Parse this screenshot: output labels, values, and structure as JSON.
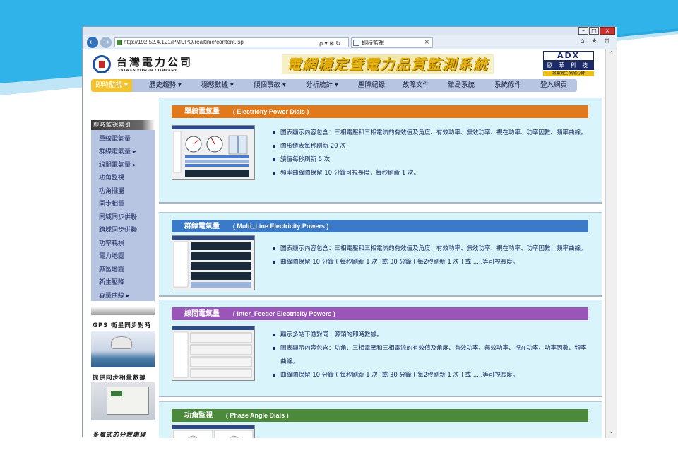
{
  "browser": {
    "url": "http://192.52.4.121/PMUPQ/realtime/content.jsp",
    "address_icons": "ρ ▾ ⊠ ↻",
    "tab_title": "即時監視",
    "tab_close": "×",
    "toolbar_icons": "⌂ ★ ⚙",
    "window_buttons": [
      "–",
      "□",
      "×"
    ],
    "back_glyph": "←",
    "forward_glyph": "→",
    "scroll_up": "⌃",
    "scroll_down": "⌄"
  },
  "header": {
    "company_name": "台灣電力公司",
    "company_name_en": "TAIWAN POWER COMPANY",
    "system_title": "電網穩定暨電力品質監測系統",
    "brand_mark": "ADX",
    "brand_name": "歐 華 科 技",
    "brand_slogan": "念動氣生‧氣隨心轉"
  },
  "menu": [
    {
      "label": "即時監視 ▾",
      "active": true
    },
    {
      "label": "歷史趨勢 ▾",
      "active": false
    },
    {
      "label": "穩態數據 ▾",
      "active": false
    },
    {
      "label": "傾個事故 ▾",
      "active": false
    },
    {
      "label": "分析統計 ▾",
      "active": false
    },
    {
      "label": "壓降紀錄",
      "active": false
    },
    {
      "label": "故障文件",
      "active": false
    },
    {
      "label": "離島系統",
      "active": false
    },
    {
      "label": "系統條件",
      "active": false
    },
    {
      "label": "登入網頁",
      "active": false
    }
  ],
  "sidebar": {
    "heading": "即時監視索引",
    "items": [
      "單線電氣量",
      "群線電氣量 ▸",
      "線間電氣量 ▸",
      "功角監視",
      "功角擺盪",
      "同步相量",
      "同域同步併聯",
      "跨域同步併聯",
      "功率耗損",
      "電力地圖",
      "廠區地圖",
      "新生壓降",
      "容量曲線 ▸"
    ],
    "gps_label": "GPS 衛星同步對時",
    "sync_label": "提供同步相量數據",
    "dist_label": "多層式的分散處理"
  },
  "sections": [
    {
      "title_cn": "單線電氣量",
      "title_en": "( Electricity Power Dials )",
      "color": "#e07a1c",
      "bullets": [
        "圖表顯示內容包含：三相電壓和三相電流的有效值及角度、有效功率、無效功率、視在功率、功率因數、頻率曲線。",
        "圖形儀表每秒刷新 20 次",
        "讀值每秒刷新 5 次",
        "頻率曲線圖保留 10 分鐘可視長度，每秒刷新 1 次。"
      ]
    },
    {
      "title_cn": "群線電氣量",
      "title_en": "( Multi_Line Electricity Powers )",
      "color": "#3a7ac8",
      "bullets": [
        "圖表顯示內容包含：三相電壓和三相電流的有效值及角度、有效功率、無效功率、視在功率、功率因數、頻率曲線。",
        "曲線圖保留 10 分鐘 ( 每秒刷新 1 次 )或 30 分鐘 ( 每2秒刷新 1 次 ) 或 .....等可視長度。"
      ]
    },
    {
      "title_cn": "線間電氣量",
      "title_en": "( Inter_Feeder Electricity Powers )",
      "color": "#9a55b8",
      "bullets": [
        "顯示多站下游對同一源頭的即時數據。",
        "圖表顯示內容包含：功角、三相電壓和三相電流的有效值及角度、有效功率、無效功率、視在功率、功率因數、頻率曲線。",
        "曲線圖保留 10 分鐘 ( 每秒刷新 1 次 )或 30 分鐘 ( 每2秒刷新 1 次 ) 或 .....等可視長度。"
      ]
    },
    {
      "title_cn": "功角監視",
      "title_en": "( Phase Angle Dials )",
      "color": "#4a8a3a",
      "bullets": []
    }
  ]
}
